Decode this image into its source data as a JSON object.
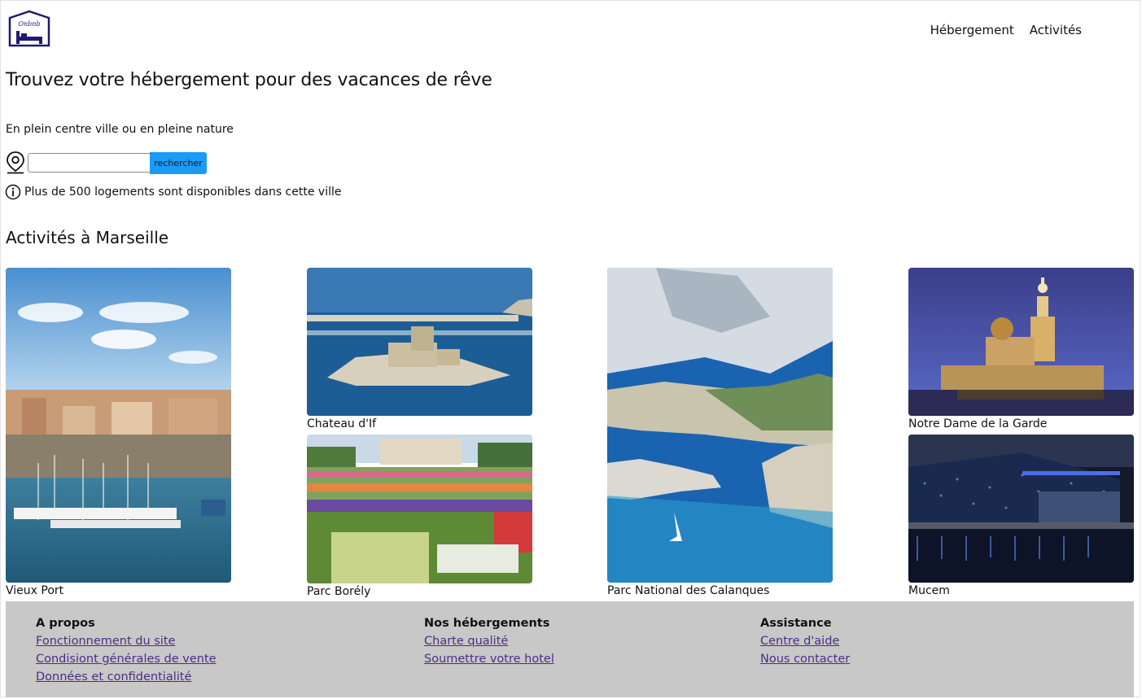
{
  "header": {
    "logo_text": "Onbnb",
    "nav": [
      {
        "label": "Hébergement"
      },
      {
        "label": "Activités"
      }
    ]
  },
  "hero": {
    "title": "Trouvez votre hébergement pour des vacances de rêve",
    "tagline": "En plein centre ville ou en pleine nature",
    "search": {
      "value": "",
      "placeholder": "",
      "button_label": "rechercher"
    },
    "info": "Plus de 500 logements sont disponibles dans cette ville"
  },
  "activities": {
    "title": "Activités à Marseille",
    "cards": [
      {
        "caption": "Vieux Port"
      },
      {
        "caption": "Chateau d'If"
      },
      {
        "caption": "Parc Borély"
      },
      {
        "caption": "Parc National des Calanques"
      },
      {
        "caption": "Notre Dame de la Garde"
      },
      {
        "caption": "Mucem"
      }
    ]
  },
  "footer": {
    "columns": [
      {
        "heading": "A propos",
        "links": [
          "Fonctionnement du site",
          "Condisiont générales de vente",
          "Données et confidentialité"
        ]
      },
      {
        "heading": "Nos hébergements",
        "links": [
          "Charte qualité",
          "Soumettre votre hotel"
        ]
      },
      {
        "heading": "Assistance",
        "links": [
          "Centre d'aide",
          "Nous contacter"
        ]
      }
    ]
  },
  "colors": {
    "accent": "#1a9bf7",
    "footer_bg": "#c8c8c8",
    "link": "#4b2e83"
  }
}
